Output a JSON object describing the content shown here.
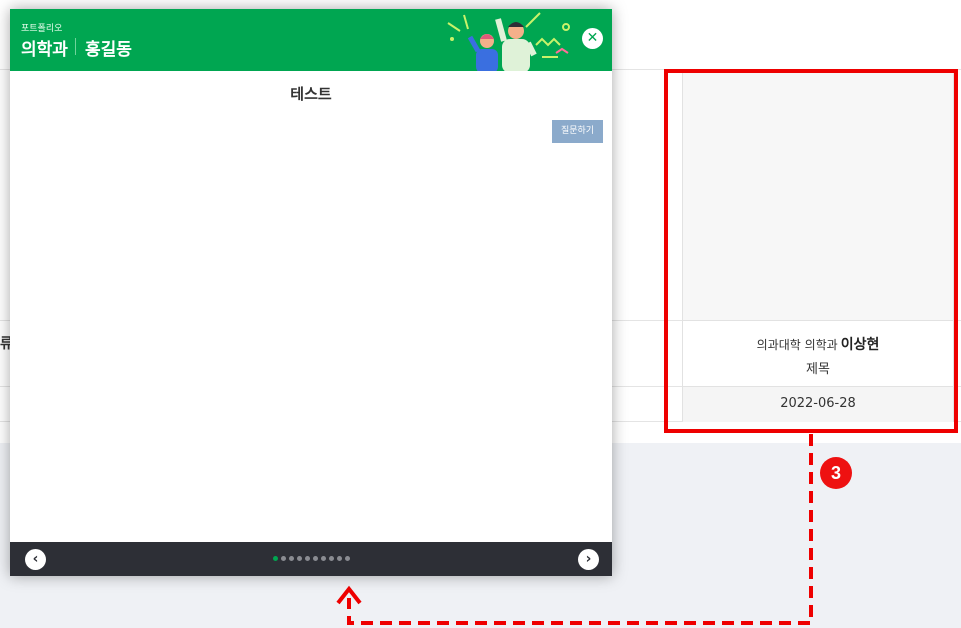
{
  "background": {
    "left_cut_text": "류"
  },
  "card": {
    "department": "의과대학 의학과",
    "name": "이상현",
    "title": "제목",
    "date": "2022-06-28"
  },
  "annotation": {
    "step_number": "3",
    "color": "#ee0000"
  },
  "modal": {
    "header": {
      "subtitle": "포트폴리오",
      "department": "의학과",
      "person": "홍길동",
      "close_icon": "close-icon",
      "color": "#00a651"
    },
    "title": "테스트",
    "ask_button_label": "질문하기",
    "footer": {
      "prev_icon": "chevron-left-icon",
      "next_icon": "chevron-right-icon",
      "page_count": 10,
      "active_page": 1
    }
  }
}
